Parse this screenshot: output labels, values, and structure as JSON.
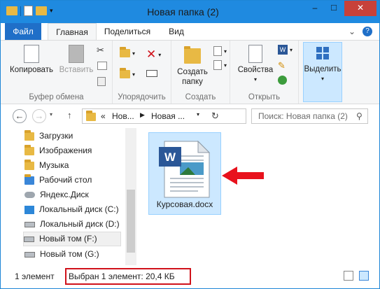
{
  "window": {
    "title": "Новая папка (2)",
    "minimize": "–",
    "maximize": "□",
    "close": "✕"
  },
  "tabs": {
    "file": "Файл",
    "home": "Главная",
    "share": "Поделиться",
    "view": "Вид"
  },
  "ribbon": {
    "clipboard": {
      "copy": "Копировать",
      "paste": "Вставить",
      "label": "Буфер обмена"
    },
    "organize": {
      "label": "Упорядочить"
    },
    "create": {
      "new_folder_line1": "Создать",
      "new_folder_line2": "папку",
      "label": "Создать"
    },
    "open": {
      "properties": "Свойства",
      "label": "Открыть"
    },
    "select": {
      "button": "Выделить"
    }
  },
  "address": {
    "overflow": "«",
    "crumb1": "Нов...",
    "crumb2": "Новая ...",
    "search_placeholder": "Поиск: Новая папка (2)"
  },
  "nav_items": [
    "Загрузки",
    "Изображения",
    "Музыка",
    "Рабочий стол",
    "Яндекс.Диск",
    "Локальный диск (C:)",
    "Локальный диск (D:)",
    "Новый том (F:)",
    "Новый том (G:)"
  ],
  "file": {
    "name": "Курсовая.docx"
  },
  "status": {
    "count": "1 элемент",
    "selected": "Выбран 1 элемент: 20,4 КБ"
  },
  "colors": {
    "titlebar": "#1f8ae0",
    "file_tab": "#1f6fc8",
    "selection": "#cce8ff",
    "annotation": "#d0121b"
  }
}
